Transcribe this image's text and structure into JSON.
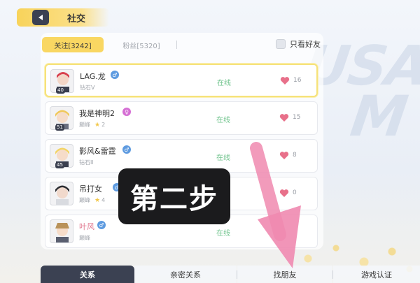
{
  "header": {
    "title": "社交"
  },
  "tabs": {
    "follow": "关注[3242]",
    "fans": "粉丝[5320]"
  },
  "filter": {
    "only_friends": "只看好友"
  },
  "friends": [
    {
      "name": "LAG.龙",
      "rank": "钻石V",
      "level": "40",
      "gender": "male",
      "status": "在线",
      "likes": "16",
      "stars": ""
    },
    {
      "name": "我是神明2",
      "rank": "巅峰",
      "level": "51",
      "gender": "female",
      "status": "在线",
      "likes": "15",
      "stars": "2"
    },
    {
      "name": "影风&雷霆",
      "rank": "钻石II",
      "level": "45",
      "gender": "male",
      "status": "在线",
      "likes": "8",
      "stars": ""
    },
    {
      "name": "吊打女",
      "rank": "巅峰",
      "level": "",
      "gender": "male",
      "status": "",
      "likes": "0",
      "stars": "4"
    },
    {
      "name": "叶风",
      "rank": "巅峰",
      "level": "",
      "gender": "male",
      "status": "在线",
      "likes": "",
      "stars": ""
    }
  ],
  "overlay": {
    "text": "第二步"
  },
  "bottom_nav": [
    "关系",
    "亲密关系",
    "找朋友",
    "游戏认证"
  ],
  "colors": {
    "accent": "#f9d762",
    "dark": "#3b4152",
    "online": "#6fc38c",
    "heart": "#e8708a",
    "arrow": "#f08ab0"
  }
}
